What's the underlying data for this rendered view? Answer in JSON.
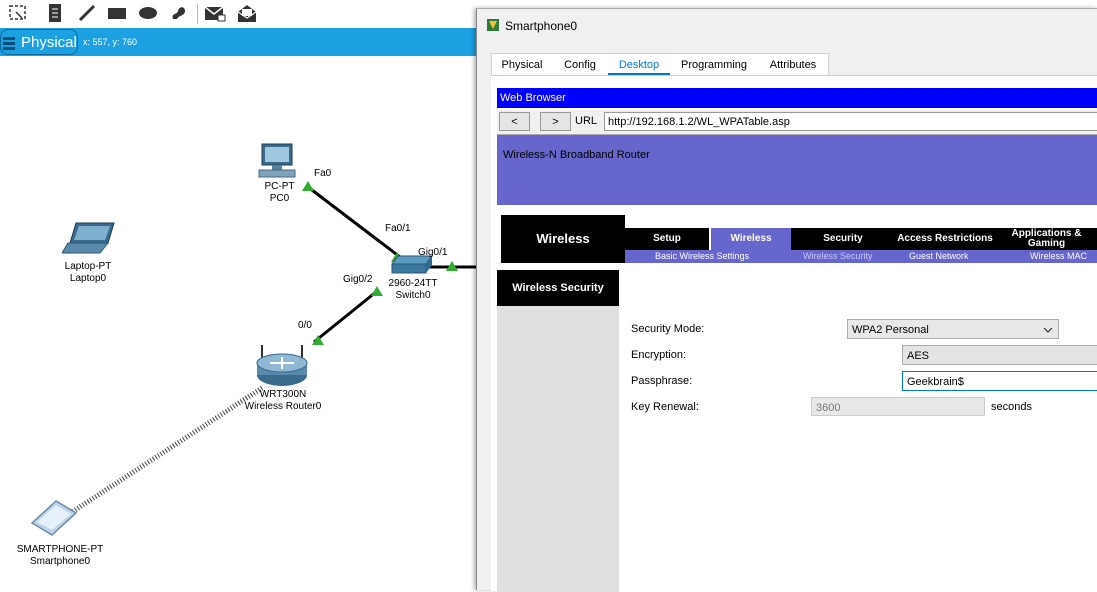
{
  "toolbar": {
    "icons": [
      "select-area-icon",
      "note-icon",
      "pencil-icon",
      "rectangle-icon",
      "ellipse-icon",
      "freeform-icon",
      "mail-icon",
      "open-envelope-icon"
    ]
  },
  "physical_bar": {
    "tab_label": "Physical",
    "coords": "x: 557, y: 760"
  },
  "devices": [
    {
      "type": "PC-PT",
      "name": "PC0"
    },
    {
      "type": "Laptop-PT",
      "name": "Laptop0"
    },
    {
      "type": "2960-24TT",
      "name": "Switch0"
    },
    {
      "type": "WRT300N",
      "name": "Wireless Router0"
    },
    {
      "type": "SMARTPHONE-PT",
      "name": "Smartphone0"
    }
  ],
  "ports": {
    "pc_fa0": "Fa0",
    "sw_fa01": "Fa0/1",
    "sw_gig01": "Gig0/1",
    "sw_gig02": "Gig0/2",
    "router_00": "0/0"
  },
  "dialog": {
    "title": "Smartphone0",
    "tabs": [
      "Physical",
      "Config",
      "Desktop",
      "Programming",
      "Attributes"
    ],
    "active_tab": "Desktop",
    "browser": {
      "title": "Web Browser",
      "back_label": "<",
      "forward_label": ">",
      "url_label": "URL",
      "url": "http://192.168.1.2/WL_WPATable.asp"
    },
    "router_page": {
      "model_name": "Wireless-N Broadband Router",
      "section": "Wireless",
      "nav_tabs": [
        "Setup",
        "Wireless",
        "Security",
        "Access Restrictions",
        "Applications & Gaming"
      ],
      "sub_nav": [
        "Basic Wireless Settings",
        "Wireless Security",
        "Guest Network",
        "Wireless MAC"
      ],
      "left_heading": "Wireless Security",
      "security_mode_label": "Security Mode:",
      "security_mode": "WPA2 Personal",
      "encryption_label": "Encryption:",
      "encryption": "AES",
      "passphrase_label": "Passphrase:",
      "passphrase": "Geekbrain$",
      "key_renewal_label": "Key Renewal:",
      "key_renewal": "3600",
      "seconds_label": "seconds"
    }
  },
  "colors": {
    "physical_bar": "#1ba1e2",
    "browser_title": "#0000ff",
    "router_banner": "#6666cc",
    "link_green": "#33aa33"
  }
}
